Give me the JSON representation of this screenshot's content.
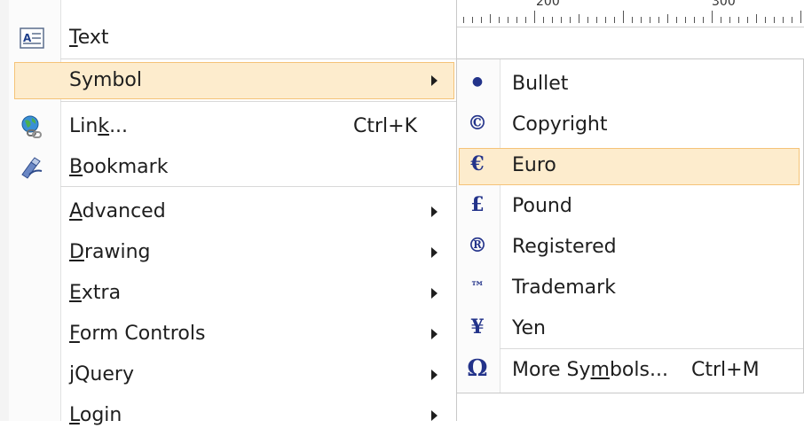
{
  "ruler": {
    "labels": [
      "200",
      "300"
    ]
  },
  "main_menu": {
    "items": [
      {
        "pre": "",
        "u": "T",
        "post": "ext",
        "shortcut": "",
        "submenu": false,
        "icon": "text-box-icon"
      },
      {
        "pre": "Symbol",
        "u": "",
        "post": "",
        "shortcut": "",
        "submenu": true,
        "icon": "",
        "highlighted": true
      },
      {
        "pre": "Lin",
        "u": "k",
        "post": "...",
        "shortcut": "Ctrl+K",
        "submenu": false,
        "icon": "globe-link-icon"
      },
      {
        "pre": "",
        "u": "B",
        "post": "ookmark",
        "shortcut": "",
        "submenu": false,
        "icon": "bookmark-pen-icon"
      },
      {
        "pre": "",
        "u": "A",
        "post": "dvanced",
        "shortcut": "",
        "submenu": true,
        "icon": ""
      },
      {
        "pre": "",
        "u": "D",
        "post": "rawing",
        "shortcut": "",
        "submenu": true,
        "icon": ""
      },
      {
        "pre": "",
        "u": "E",
        "post": "xtra",
        "shortcut": "",
        "submenu": true,
        "icon": ""
      },
      {
        "pre": "",
        "u": "F",
        "post": "orm Controls",
        "shortcut": "",
        "submenu": true,
        "icon": ""
      },
      {
        "pre": "jQuery",
        "u": "",
        "post": "",
        "shortcut": "",
        "submenu": true,
        "icon": ""
      },
      {
        "pre": "",
        "u": "L",
        "post": "ogin",
        "shortcut": "",
        "submenu": true,
        "icon": ""
      }
    ]
  },
  "symbol_submenu": {
    "items": [
      {
        "symbol": "●",
        "label": "Bullet",
        "shortcut": ""
      },
      {
        "symbol": "©",
        "label": "Copyright",
        "shortcut": ""
      },
      {
        "symbol": "€",
        "label": "Euro",
        "shortcut": "",
        "highlighted": true
      },
      {
        "symbol": "£",
        "label": "Pound",
        "shortcut": ""
      },
      {
        "symbol": "®",
        "label": "Registered",
        "shortcut": ""
      },
      {
        "symbol": "™",
        "label": "Trademark",
        "shortcut": ""
      },
      {
        "symbol": "¥",
        "label": "Yen",
        "shortcut": ""
      },
      {
        "symbol": "Ω",
        "label_pre": "More Sy",
        "label_u": "m",
        "label_post": "bols...",
        "shortcut": "Ctrl+M"
      }
    ]
  },
  "colors": {
    "highlight": "#fdeccd",
    "highlight_border": "#f5c378",
    "symbol": "#23338a"
  }
}
